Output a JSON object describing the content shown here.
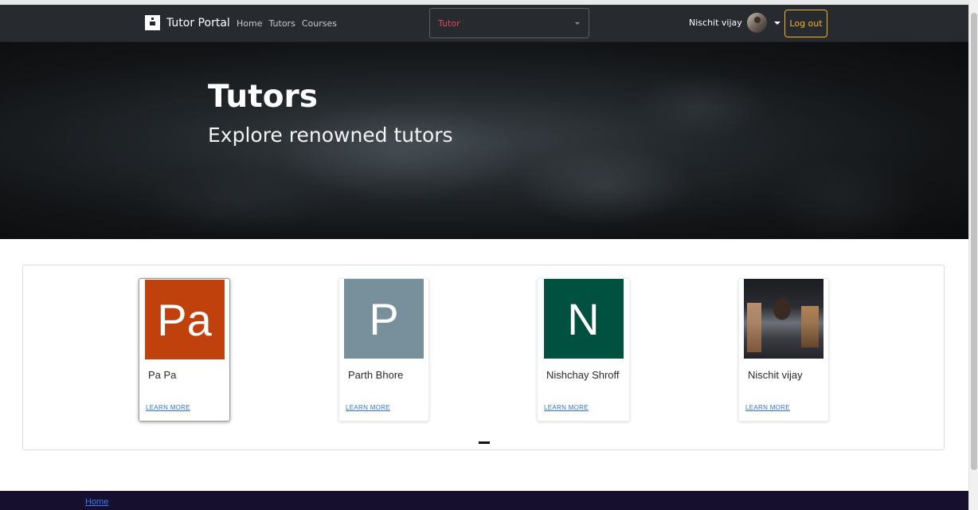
{
  "navbar": {
    "brand": "Tutor Portal",
    "links": [
      "Home",
      "Tutors",
      "Courses"
    ],
    "role_select": {
      "value": "Tutor"
    },
    "user_name": "Nischit vijay",
    "logout_label": "Log out"
  },
  "hero": {
    "title": "Tutors",
    "subtitle": "Explore renowned tutors"
  },
  "tutors": [
    {
      "initials": "Pa",
      "name": "Pa Pa",
      "link": "LEARN MORE",
      "color": "#c1410c"
    },
    {
      "initials": "P",
      "name": "Parth Bhore",
      "link": "LEARN MORE",
      "color": "#78909c"
    },
    {
      "initials": "N",
      "name": "Nishchay Shroff",
      "link": "LEARN MORE",
      "color": "#00513f"
    },
    {
      "initials": "",
      "name": "Nischit vijay",
      "link": "LEARN MORE",
      "color": ""
    }
  ],
  "footer": {
    "link": "Home"
  },
  "colors": {
    "navbar_bg": "#272b30",
    "accent_warning": "#f0b429",
    "select_text": "#e0464d",
    "footer_bg": "#160f2e",
    "link": "#2f6fd6"
  }
}
